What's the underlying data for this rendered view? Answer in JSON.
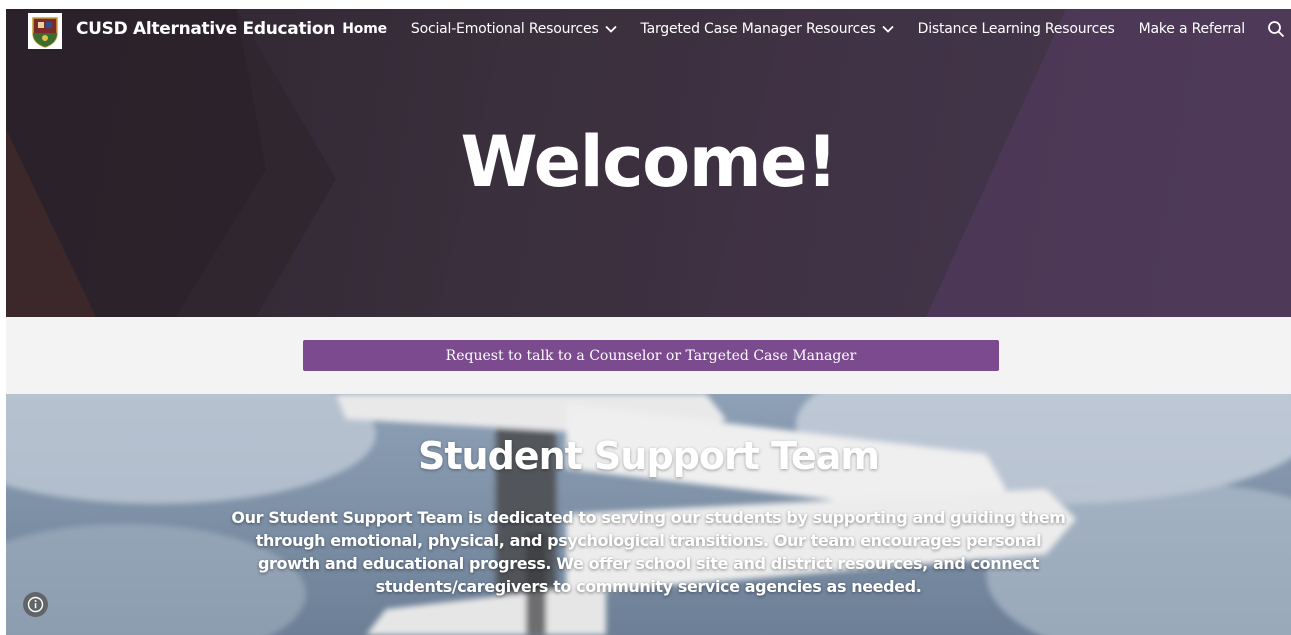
{
  "site": {
    "title": "CUSD Alternative Education"
  },
  "nav": {
    "items": [
      {
        "label": "Home",
        "active": true,
        "dropdown": false
      },
      {
        "label": "Social-Emotional Resources",
        "active": false,
        "dropdown": true
      },
      {
        "label": "Targeted Case Manager Resources",
        "active": false,
        "dropdown": true
      },
      {
        "label": "Distance Learning Resources",
        "active": false,
        "dropdown": false
      },
      {
        "label": "Make a Referral",
        "active": false,
        "dropdown": false
      }
    ],
    "search_icon": "search-icon",
    "chevron_icon": "chevron-down-icon"
  },
  "hero": {
    "heading": "Welcome!"
  },
  "referral": {
    "button_label": "Request to talk to a Counselor or Targeted Case Manager"
  },
  "support": {
    "heading": "Student Support Team",
    "body": "Our Student Support Team is dedicated to serving our students by supporting and guiding them through emotional, physical, and psychological transitions.  Our team encourages personal growth and educational progress. We offer school site and district resources, and connect students/caregivers to community service agencies as needed."
  },
  "colors": {
    "accent_button": "#7c4a8e",
    "hero_dark": "#2e2530",
    "hero_purple": "#4e3a57",
    "band_background": "#f3f3f3"
  },
  "icons": {
    "info": "info-icon",
    "logo": "school-crest-logo"
  }
}
